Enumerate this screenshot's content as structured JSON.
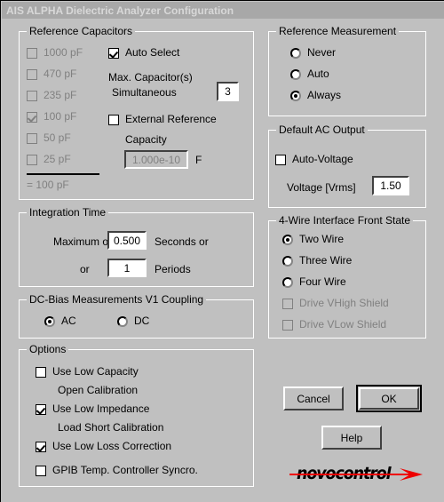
{
  "window": {
    "title": "AIS ALPHA Dielectric Analyzer Configuration"
  },
  "reference_capacitors": {
    "legend": "Reference Capacitors",
    "capacitors": [
      {
        "label": "1000 pF",
        "checked": false
      },
      {
        "label": "470 pF",
        "checked": false
      },
      {
        "label": "235 pF",
        "checked": false
      },
      {
        "label": "100 pF",
        "checked": true
      },
      {
        "label": "50 pF",
        "checked": false
      },
      {
        "label": "25 pF",
        "checked": false
      }
    ],
    "sum_label": "= 100 pF",
    "auto_select": {
      "label": "Auto Select",
      "checked": true
    },
    "max_cap_line1": "Max. Capacitor(s)",
    "max_cap_line2": "Simultaneous",
    "max_cap_value": "3",
    "external_reference": {
      "label": "External Reference",
      "checked": false
    },
    "capacity_label": "Capacity",
    "capacity_value": "1.000e-10",
    "capacity_unit": "F"
  },
  "integration_time": {
    "legend": "Integration Time",
    "maximum_label": "Maximum of",
    "seconds_value": "0.500",
    "seconds_unit": "Seconds or",
    "or_label": "or",
    "periods_value": "1",
    "periods_unit": "Periods"
  },
  "dc_bias": {
    "legend": "DC-Bias Measurements V1 Coupling",
    "options": [
      {
        "label": "AC",
        "selected": true
      },
      {
        "label": "DC",
        "selected": false
      }
    ]
  },
  "options": {
    "legend": "Options",
    "items": [
      {
        "label": "Use Low Capacity",
        "sublabel": "Open Calibration",
        "checked": false
      },
      {
        "label": "Use Low Impedance",
        "sublabel": "Load Short Calibration",
        "checked": true
      },
      {
        "label": "Use Low Loss Correction",
        "sublabel": "",
        "checked": true
      },
      {
        "label": "GPIB Temp. Controller Syncro.",
        "sublabel": "",
        "checked": false
      }
    ]
  },
  "reference_measurement": {
    "legend": "Reference Measurement",
    "options": [
      {
        "label": "Never",
        "selected": false
      },
      {
        "label": "Auto",
        "selected": false
      },
      {
        "label": "Always",
        "selected": true
      }
    ]
  },
  "default_ac_output": {
    "legend": "Default AC Output",
    "auto_voltage": {
      "label": "Auto-Voltage",
      "checked": false
    },
    "voltage_label": "Voltage [Vrms]",
    "voltage_value": "1.50"
  },
  "four_wire": {
    "legend": "4-Wire Interface Front State",
    "options": [
      {
        "label": "Two Wire",
        "selected": true
      },
      {
        "label": "Three Wire",
        "selected": false
      },
      {
        "label": "Four Wire",
        "selected": false
      }
    ],
    "shields": [
      {
        "label": "Drive VHigh Shield",
        "checked": false
      },
      {
        "label": "Drive VLow Shield",
        "checked": false
      }
    ]
  },
  "buttons": {
    "cancel": "Cancel",
    "ok": "OK",
    "help": "Help"
  },
  "logo": {
    "text": "novocontrol",
    "accent_color": "#ee0000"
  },
  "colors": {
    "face": "#c0c0c0",
    "titlebar": "#a8a8a8",
    "titlebar_text": "#d8d8d8",
    "disabled_text": "#808080"
  }
}
